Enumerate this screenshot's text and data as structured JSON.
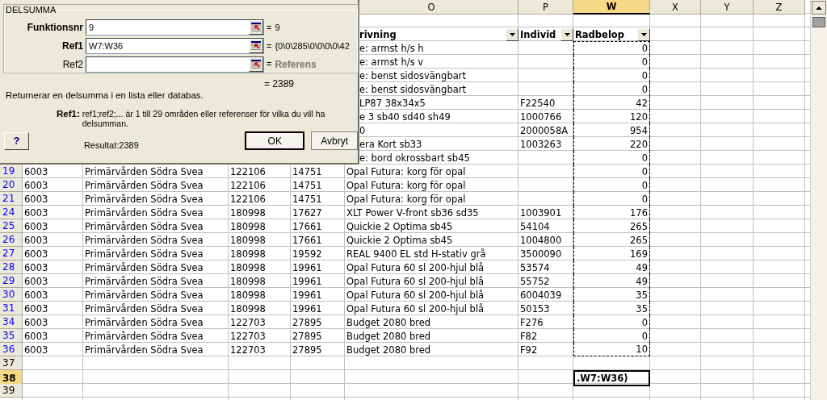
{
  "dialog": {
    "group_title": "DELSUMMA",
    "arguments": [
      {
        "label": "Funktionsnr",
        "value": "9",
        "sign": "=",
        "result": "9",
        "required": true
      },
      {
        "label": "Ref1",
        "value": "W7:W36",
        "sign": "=",
        "result": "{0\\0\\285\\0\\0\\0\\0\\42",
        "required": true
      },
      {
        "label": "Ref2",
        "sign": "=",
        "result": "Referens",
        "required": false
      }
    ],
    "formula_result": "= 2389",
    "description": "Returnerar en delsumma i en lista eller databas.",
    "argument_help": {
      "label": "Ref1:",
      "text": "ref1;ref2;... är 1 till 29 områden eller referenser för vilka du vill ha delsumman."
    },
    "help_button": "?",
    "result_text": "Resultat:2389",
    "buttons": [
      {
        "label": "OK",
        "default": true
      },
      {
        "label": "Avbryt",
        "default": false
      }
    ]
  },
  "columns": [
    {
      "label": "O",
      "selected": false
    },
    {
      "label": "P",
      "selected": false
    },
    {
      "label": "W",
      "selected": true
    },
    {
      "label": "X",
      "selected": false
    },
    {
      "label": "Y",
      "selected": false
    },
    {
      "label": "Z",
      "selected": false
    }
  ],
  "rows": [
    {
      "kind": "blank",
      "selected": false,
      "in_range": false
    },
    {
      "kind": "header",
      "o": "rivning",
      "p": "Individ",
      "w": "Radbelop",
      "selected": false,
      "in_range": false
    },
    {
      "kind": "data",
      "o": "e: armst h/s h",
      "w": "0",
      "selected": false,
      "in_range": true
    },
    {
      "kind": "data",
      "o": "e: armst h/s v",
      "w": "0",
      "selected": false,
      "in_range": true
    },
    {
      "kind": "data",
      "o": "e: benst sidosvängbart",
      "w": "0",
      "selected": false,
      "in_range": true
    },
    {
      "kind": "data",
      "o": "e: benst sidosvängbart",
      "w": "0",
      "selected": false,
      "in_range": true
    },
    {
      "kind": "data",
      "o": "LP87 38x34x5",
      "p": "F22540",
      "w": "42",
      "selected": false,
      "in_range": true
    },
    {
      "kind": "data",
      "o": "e 3 sb40 sd40 sh49",
      "p": "1000766",
      "w": "120",
      "selected": false,
      "in_range": true
    },
    {
      "kind": "data",
      "o": "0",
      "p": "2000058A",
      "w": "954",
      "selected": false,
      "in_range": true
    },
    {
      "kind": "data",
      "o": "era Kort sb33",
      "p": "1003263",
      "w": "220",
      "selected": false,
      "in_range": true
    },
    {
      "kind": "data",
      "o": "e: bord okrossbart sb45",
      "w": "0",
      "selected": false,
      "in_range": true
    },
    {
      "kind": "data",
      "number": "19",
      "filtered": true,
      "column_1": "6003",
      "column_2": "Primärvården Södra Svea",
      "column_3": "122106",
      "column_4": "14751",
      "o": "Opal Futura: korg för opal",
      "w": "0",
      "selected": false,
      "in_range": true
    },
    {
      "kind": "data",
      "number": "20",
      "filtered": true,
      "column_1": "6003",
      "column_2": "Primärvården Södra Svea",
      "column_3": "122106",
      "column_4": "14751",
      "o": "Opal Futura: korg för opal",
      "w": "0",
      "selected": false,
      "in_range": true
    },
    {
      "kind": "data",
      "number": "21",
      "filtered": true,
      "column_1": "6003",
      "column_2": "Primärvården Södra Svea",
      "column_3": "122106",
      "column_4": "14751",
      "o": "Opal Futura: korg för opal",
      "w": "0",
      "selected": false,
      "in_range": true
    },
    {
      "kind": "data",
      "number": "24",
      "filtered": true,
      "column_1": "6003",
      "column_2": "Primärvården Södra Svea",
      "column_3": "180998",
      "column_4": "17627",
      "o": "XLT Power V-front sb36 sd35",
      "p": "1003901",
      "w": "176",
      "selected": false,
      "in_range": true
    },
    {
      "kind": "data",
      "number": "25",
      "filtered": true,
      "column_1": "6003",
      "column_2": "Primärvården Södra Svea",
      "column_3": "180998",
      "column_4": "17661",
      "o": "Quickie 2 Optima sb45",
      "p": "54104",
      "w": "265",
      "selected": false,
      "in_range": true
    },
    {
      "kind": "data",
      "number": "26",
      "filtered": true,
      "column_1": "6003",
      "column_2": "Primärvården Södra Svea",
      "column_3": "180998",
      "column_4": "17661",
      "o": "Quickie 2 Optima sb45",
      "p": "1004800",
      "w": "265",
      "selected": false,
      "in_range": true
    },
    {
      "kind": "data",
      "number": "27",
      "filtered": true,
      "column_1": "6003",
      "column_2": "Primärvården Södra Svea",
      "column_3": "180998",
      "column_4": "19592",
      "o": "REAL 9400 EL std H-stativ grå",
      "p": "3500090",
      "w": "169",
      "selected": false,
      "in_range": true
    },
    {
      "kind": "data",
      "number": "28",
      "filtered": true,
      "column_1": "6003",
      "column_2": "Primärvården Södra Svea",
      "column_3": "180998",
      "column_4": "19961",
      "o": "Opal Futura 60 sl 200-hjul blå",
      "p": "53574",
      "w": "49",
      "selected": false,
      "in_range": true
    },
    {
      "kind": "data",
      "number": "29",
      "filtered": true,
      "column_1": "6003",
      "column_2": "Primärvården Södra Svea",
      "column_3": "180998",
      "column_4": "19961",
      "o": "Opal Futura 60 sl 200-hjul blå",
      "p": "55752",
      "w": "49",
      "selected": false,
      "in_range": true
    },
    {
      "kind": "data",
      "number": "30",
      "filtered": true,
      "column_1": "6003",
      "column_2": "Primärvården Södra Svea",
      "column_3": "180998",
      "column_4": "19961",
      "o": "Opal Futura 60 sl 200-hjul blå",
      "p": "6004039",
      "w": "35",
      "selected": false,
      "in_range": true
    },
    {
      "kind": "data",
      "number": "31",
      "filtered": true,
      "column_1": "6003",
      "column_2": "Primärvården Södra Svea",
      "column_3": "180998",
      "column_4": "19961",
      "o": "Opal Futura 60 sl 200-hjul blå",
      "p": "50153",
      "w": "35",
      "selected": false,
      "in_range": true
    },
    {
      "kind": "data",
      "number": "34",
      "filtered": true,
      "column_1": "6003",
      "column_2": "Primärvården Södra Svea",
      "column_3": "122703",
      "column_4": "27895",
      "o": "Budget 2080 bred",
      "p": "F276",
      "w": "0",
      "selected": false,
      "in_range": true
    },
    {
      "kind": "data",
      "number": "35",
      "filtered": true,
      "column_1": "6003",
      "column_2": "Primärvården Södra Svea",
      "column_3": "122703",
      "column_4": "27895",
      "o": "Budget 2080 bred",
      "p": "F82",
      "w": "0",
      "selected": false,
      "in_range": true
    },
    {
      "kind": "data",
      "number": "36",
      "filtered": true,
      "column_1": "6003",
      "column_2": "Primärvården Södra Svea",
      "column_3": "122703",
      "column_4": "27895",
      "o": "Budget 2080 bred",
      "p": "F92",
      "w": "10",
      "selected": false,
      "in_range": true
    },
    {
      "kind": "data",
      "number": "37",
      "filtered": false,
      "selected": false,
      "in_range": false
    },
    {
      "kind": "data",
      "number": "38",
      "filtered": false,
      "w": ".W7:W36)",
      "selected": true,
      "in_range": false
    },
    {
      "kind": "data",
      "number": "39",
      "filtered": false,
      "selected": false,
      "in_range": false
    }
  ]
}
